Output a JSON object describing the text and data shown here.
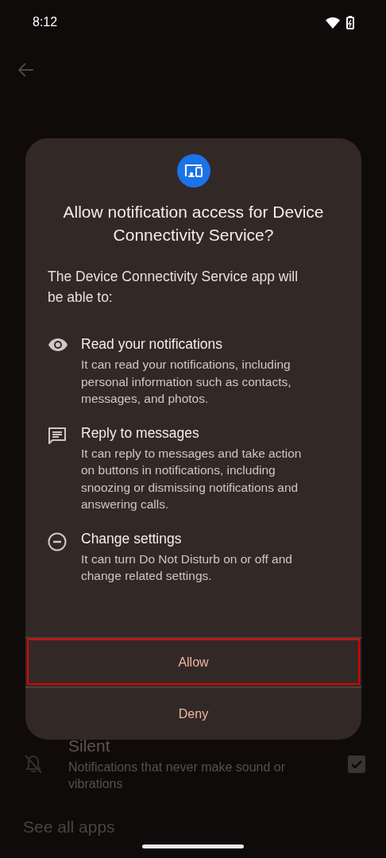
{
  "status_bar": {
    "time": "8:12"
  },
  "background": {
    "row": {
      "title": "Silent",
      "description": "Notifications that never make sound or vibrations",
      "checked": true
    },
    "link": "See all apps"
  },
  "dialog": {
    "title": "Allow notification access for Device Connectivity Service?",
    "intro": "The Device Connectivity Service app will be able to:",
    "permissions": [
      {
        "kind": "eye",
        "title": "Read your notifications",
        "description": "It can read your notifications, including personal information such as contacts, messages, and photos."
      },
      {
        "kind": "message",
        "title": "Reply to messages",
        "description": "It can reply to messages and take action on buttons in notifications, including snoozing or dismissing notifications and answering calls."
      },
      {
        "kind": "minus",
        "title": "Change settings",
        "description": "It can turn Do Not Disturb on or off and change related settings."
      }
    ],
    "buttons": [
      {
        "label": "Allow",
        "highlighted": true
      },
      {
        "label": "Deny",
        "highlighted": false
      }
    ]
  }
}
